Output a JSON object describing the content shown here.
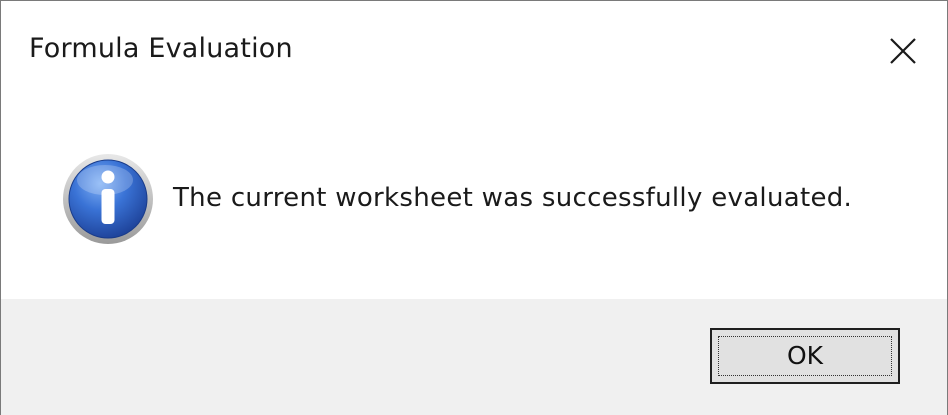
{
  "window": {
    "title": "Formula Evaluation"
  },
  "title_bar": {
    "close_icon": "close-icon"
  },
  "message": {
    "icon": "info-icon",
    "text": "The current worksheet was successfully evaluated."
  },
  "footer": {
    "ok_label": "OK"
  },
  "colors": {
    "footer_background": "#f0f0f0",
    "info_icon_blue": "#2f63c8",
    "button_face": "#e1e1e1"
  }
}
